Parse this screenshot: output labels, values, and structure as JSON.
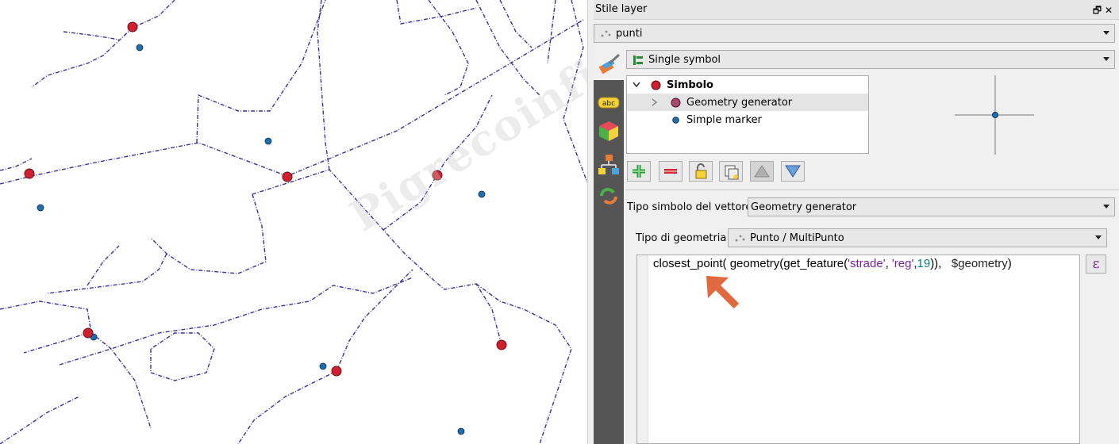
{
  "panel": {
    "title": "Stile layer",
    "window_buttons": "🗗 ✕",
    "layer_combo": "punti",
    "renderer_combo": "Single symbol",
    "symbol_tree": [
      {
        "label": "Simbolo",
        "bold": true
      },
      {
        "label": "Geometry generator",
        "bold": false,
        "selected": true
      },
      {
        "label": "Simple marker",
        "bold": false
      }
    ],
    "symbol_type_label": "Tipo simbolo del vettore",
    "symbol_type_value": "Geometry generator",
    "geometry_type_label": "Tipo di geometria",
    "geometry_type_value": "Punto / MultiPunto",
    "expression": {
      "fn": "closest_point( geometry(get_feature(",
      "str1": "'strade'",
      "sep": ", ",
      "str2": "'reg'",
      "comma": ",",
      "num": "19",
      "close": ")),   ",
      "var": "$geometry",
      "end": ")"
    },
    "expression_button": "ε"
  },
  "map": {
    "watermark": "Pigrecoinfinito"
  },
  "colors": {
    "road": "#3d2f9c",
    "red_point": "#d01f2e",
    "blue_point": "#1f6fb0",
    "arrow": "#e0693f"
  }
}
